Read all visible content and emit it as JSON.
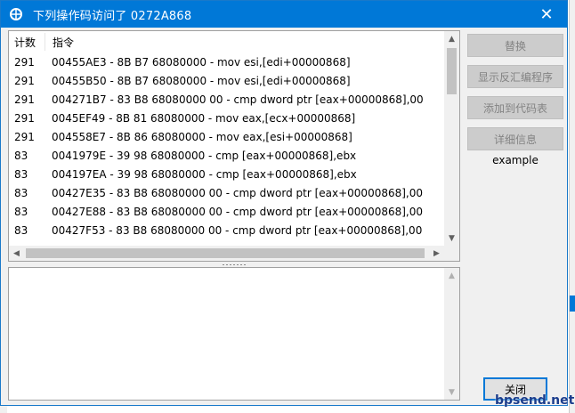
{
  "window": {
    "title": "下列操作码访问了 0272A868",
    "close_glyph": "✕"
  },
  "list": {
    "headers": {
      "count": "计数",
      "instruction": "指令"
    },
    "rows": [
      {
        "count": "291",
        "instruction": "00455AE3 - 8B B7 68080000  - mov esi,[edi+00000868]"
      },
      {
        "count": "291",
        "instruction": "00455B50 - 8B B7 68080000  - mov esi,[edi+00000868]"
      },
      {
        "count": "291",
        "instruction": "004271B7 - 83 B8 68080000 00 - cmp dword ptr [eax+00000868],00"
      },
      {
        "count": "291",
        "instruction": "0045EF49 - 8B 81 68080000  - mov eax,[ecx+00000868]"
      },
      {
        "count": "291",
        "instruction": "004558E7 - 8B 86 68080000  - mov eax,[esi+00000868]"
      },
      {
        "count": "83",
        "instruction": "0041979E - 39 98 68080000  - cmp [eax+00000868],ebx"
      },
      {
        "count": "83",
        "instruction": "004197EA - 39 98 68080000  - cmp [eax+00000868],ebx"
      },
      {
        "count": "83",
        "instruction": "00427E35 - 83 B8 68080000 00 - cmp dword ptr [eax+00000868],00"
      },
      {
        "count": "83",
        "instruction": "00427E88 - 83 B8 68080000 00 - cmp dword ptr [eax+00000868],00"
      },
      {
        "count": "83",
        "instruction": "00427F53 - 83 B8 68080000 00 - cmp dword ptr [eax+00000868],00"
      }
    ]
  },
  "buttons": {
    "replace": "替换",
    "show_disassembler": "显示反汇编程序",
    "add_to_codelist": "添加到代码表",
    "details": "详细信息",
    "close": "关闭"
  },
  "example_label": "example",
  "watermark": "bpsend.net",
  "colors": {
    "titlebar": "#0078d7",
    "disabled_button": "#cccccc",
    "disabled_text": "#838383"
  }
}
